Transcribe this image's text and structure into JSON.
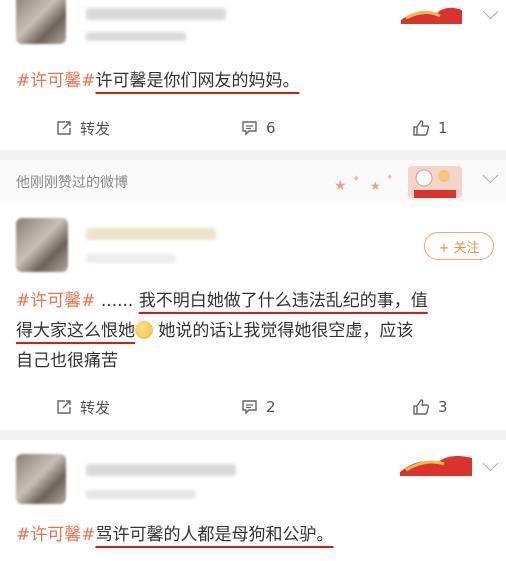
{
  "posts": [
    {
      "hashtag": "#许可馨#",
      "body": "许可馨是你们网友的妈妈。",
      "actions": {
        "repost_label": "转发",
        "comment_count": "6",
        "like_count": "1"
      }
    },
    {
      "hashtag": "#许可馨#",
      "ellipsis": " ...... ",
      "body_part1": "我不明白她做了什么违法乱纪的事，值",
      "body_part2": "得大家这么恨她",
      "body_part3": "她说的话让我觉得她很空虚，应该",
      "body_part4": "自己也很痛苦",
      "follow_label": "+ 关注",
      "actions": {
        "repost_label": "转发",
        "comment_count": "2",
        "like_count": "3"
      }
    },
    {
      "hashtag": "#许可馨#",
      "body": "骂许可馨的人都是母狗和公驴。"
    }
  ],
  "liked_header": "他刚刚赞过的微博",
  "colors": {
    "hashtag": "#eb7350",
    "underline": "#d41b1b",
    "follow": "#f08c43"
  }
}
